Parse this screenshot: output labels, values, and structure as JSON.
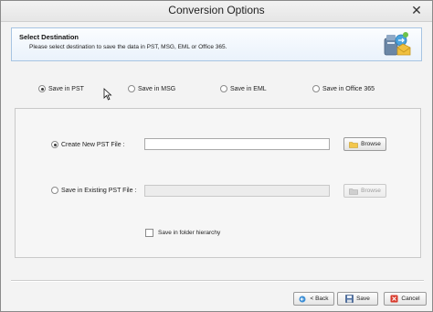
{
  "window": {
    "title": "Conversion Options",
    "close_glyph": "✕"
  },
  "header": {
    "title": "Select Destination",
    "subtitle": "Please select destination to save the data in PST, MSG, EML or Office 365.",
    "icon": "mailbox-export-icon"
  },
  "destinations": [
    {
      "label": "Save in PST",
      "selected": true
    },
    {
      "label": "Save in MSG",
      "selected": false
    },
    {
      "label": "Save in EML",
      "selected": false
    },
    {
      "label": "Save in Office 365",
      "selected": false
    }
  ],
  "pst_options": {
    "create_new": {
      "label": "Create New PST File :",
      "selected": true,
      "value": "",
      "browse_label": "Browse",
      "enabled": true
    },
    "existing": {
      "label": "Save in Existing PST File :",
      "selected": false,
      "value": "",
      "browse_label": "Browse",
      "enabled": false
    },
    "folder_hierarchy": {
      "label": "Save in folder hierarchy",
      "checked": false
    }
  },
  "footer": {
    "back_label": "< Back",
    "save_label": "Save",
    "cancel_label": "Cancel"
  }
}
